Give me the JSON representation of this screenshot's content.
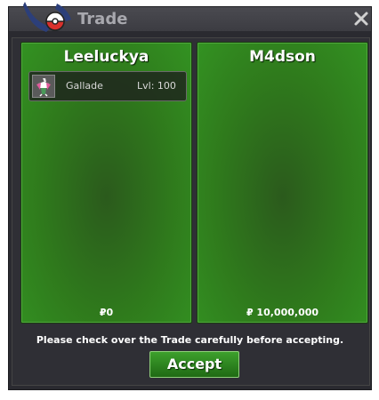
{
  "window": {
    "title": "Trade"
  },
  "left_panel": {
    "player_name": "Leeluckya",
    "items": [
      {
        "pokemon": "Gallade",
        "level": "Lvl: 100",
        "icon": "gallade-sprite"
      }
    ],
    "money": "₽0"
  },
  "right_panel": {
    "player_name": "M4dson",
    "items": [],
    "money": "₽ 10,000,000"
  },
  "notice": "Please check over the Trade carefully before accepting.",
  "accept_label": "Accept",
  "colors": {
    "panel_green": "#2f7a1c",
    "accept_green": "#2e8a22",
    "window_bg": "#2a2a30"
  }
}
